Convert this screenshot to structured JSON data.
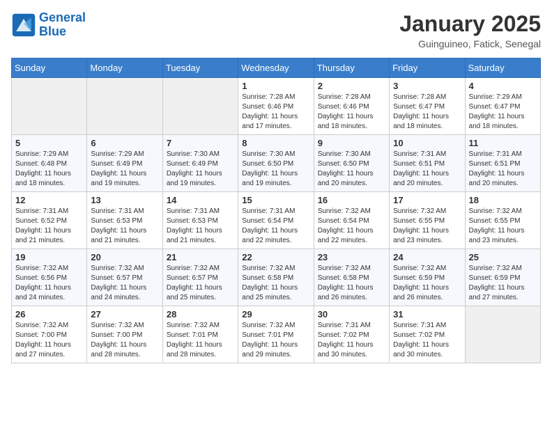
{
  "logo": {
    "line1": "General",
    "line2": "Blue"
  },
  "title": "January 2025",
  "location": "Guinguineo, Fatick, Senegal",
  "days_of_week": [
    "Sunday",
    "Monday",
    "Tuesday",
    "Wednesday",
    "Thursday",
    "Friday",
    "Saturday"
  ],
  "weeks": [
    [
      {
        "day": "",
        "content": ""
      },
      {
        "day": "",
        "content": ""
      },
      {
        "day": "",
        "content": ""
      },
      {
        "day": "1",
        "content": "Sunrise: 7:28 AM\nSunset: 6:46 PM\nDaylight: 11 hours and 17 minutes."
      },
      {
        "day": "2",
        "content": "Sunrise: 7:28 AM\nSunset: 6:46 PM\nDaylight: 11 hours and 18 minutes."
      },
      {
        "day": "3",
        "content": "Sunrise: 7:28 AM\nSunset: 6:47 PM\nDaylight: 11 hours and 18 minutes."
      },
      {
        "day": "4",
        "content": "Sunrise: 7:29 AM\nSunset: 6:47 PM\nDaylight: 11 hours and 18 minutes."
      }
    ],
    [
      {
        "day": "5",
        "content": "Sunrise: 7:29 AM\nSunset: 6:48 PM\nDaylight: 11 hours and 18 minutes."
      },
      {
        "day": "6",
        "content": "Sunrise: 7:29 AM\nSunset: 6:49 PM\nDaylight: 11 hours and 19 minutes."
      },
      {
        "day": "7",
        "content": "Sunrise: 7:30 AM\nSunset: 6:49 PM\nDaylight: 11 hours and 19 minutes."
      },
      {
        "day": "8",
        "content": "Sunrise: 7:30 AM\nSunset: 6:50 PM\nDaylight: 11 hours and 19 minutes."
      },
      {
        "day": "9",
        "content": "Sunrise: 7:30 AM\nSunset: 6:50 PM\nDaylight: 11 hours and 20 minutes."
      },
      {
        "day": "10",
        "content": "Sunrise: 7:31 AM\nSunset: 6:51 PM\nDaylight: 11 hours and 20 minutes."
      },
      {
        "day": "11",
        "content": "Sunrise: 7:31 AM\nSunset: 6:51 PM\nDaylight: 11 hours and 20 minutes."
      }
    ],
    [
      {
        "day": "12",
        "content": "Sunrise: 7:31 AM\nSunset: 6:52 PM\nDaylight: 11 hours and 21 minutes."
      },
      {
        "day": "13",
        "content": "Sunrise: 7:31 AM\nSunset: 6:53 PM\nDaylight: 11 hours and 21 minutes."
      },
      {
        "day": "14",
        "content": "Sunrise: 7:31 AM\nSunset: 6:53 PM\nDaylight: 11 hours and 21 minutes."
      },
      {
        "day": "15",
        "content": "Sunrise: 7:31 AM\nSunset: 6:54 PM\nDaylight: 11 hours and 22 minutes."
      },
      {
        "day": "16",
        "content": "Sunrise: 7:32 AM\nSunset: 6:54 PM\nDaylight: 11 hours and 22 minutes."
      },
      {
        "day": "17",
        "content": "Sunrise: 7:32 AM\nSunset: 6:55 PM\nDaylight: 11 hours and 23 minutes."
      },
      {
        "day": "18",
        "content": "Sunrise: 7:32 AM\nSunset: 6:55 PM\nDaylight: 11 hours and 23 minutes."
      }
    ],
    [
      {
        "day": "19",
        "content": "Sunrise: 7:32 AM\nSunset: 6:56 PM\nDaylight: 11 hours and 24 minutes."
      },
      {
        "day": "20",
        "content": "Sunrise: 7:32 AM\nSunset: 6:57 PM\nDaylight: 11 hours and 24 minutes."
      },
      {
        "day": "21",
        "content": "Sunrise: 7:32 AM\nSunset: 6:57 PM\nDaylight: 11 hours and 25 minutes."
      },
      {
        "day": "22",
        "content": "Sunrise: 7:32 AM\nSunset: 6:58 PM\nDaylight: 11 hours and 25 minutes."
      },
      {
        "day": "23",
        "content": "Sunrise: 7:32 AM\nSunset: 6:58 PM\nDaylight: 11 hours and 26 minutes."
      },
      {
        "day": "24",
        "content": "Sunrise: 7:32 AM\nSunset: 6:59 PM\nDaylight: 11 hours and 26 minutes."
      },
      {
        "day": "25",
        "content": "Sunrise: 7:32 AM\nSunset: 6:59 PM\nDaylight: 11 hours and 27 minutes."
      }
    ],
    [
      {
        "day": "26",
        "content": "Sunrise: 7:32 AM\nSunset: 7:00 PM\nDaylight: 11 hours and 27 minutes."
      },
      {
        "day": "27",
        "content": "Sunrise: 7:32 AM\nSunset: 7:00 PM\nDaylight: 11 hours and 28 minutes."
      },
      {
        "day": "28",
        "content": "Sunrise: 7:32 AM\nSunset: 7:01 PM\nDaylight: 11 hours and 28 minutes."
      },
      {
        "day": "29",
        "content": "Sunrise: 7:32 AM\nSunset: 7:01 PM\nDaylight: 11 hours and 29 minutes."
      },
      {
        "day": "30",
        "content": "Sunrise: 7:31 AM\nSunset: 7:02 PM\nDaylight: 11 hours and 30 minutes."
      },
      {
        "day": "31",
        "content": "Sunrise: 7:31 AM\nSunset: 7:02 PM\nDaylight: 11 hours and 30 minutes."
      },
      {
        "day": "",
        "content": ""
      }
    ]
  ]
}
